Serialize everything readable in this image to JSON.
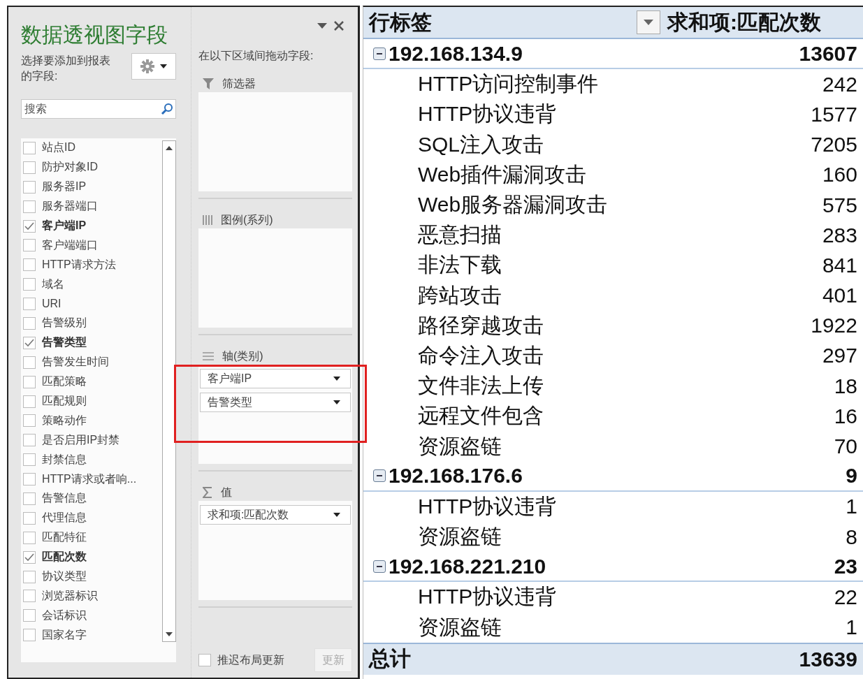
{
  "field_panel": {
    "title": "数据透视图字段",
    "instruction": "选择要添加到报表的字段:",
    "search": {
      "placeholder": "搜索"
    },
    "fields": [
      {
        "label": "站点ID",
        "checked": false
      },
      {
        "label": "防护对象ID",
        "checked": false
      },
      {
        "label": "服务器IP",
        "checked": false
      },
      {
        "label": "服务器端口",
        "checked": false
      },
      {
        "label": "客户端IP",
        "checked": true
      },
      {
        "label": "客户端端口",
        "checked": false
      },
      {
        "label": "HTTP请求方法",
        "checked": false
      },
      {
        "label": "域名",
        "checked": false
      },
      {
        "label": "URI",
        "checked": false
      },
      {
        "label": "告警级别",
        "checked": false
      },
      {
        "label": "告警类型",
        "checked": true
      },
      {
        "label": "告警发生时间",
        "checked": false
      },
      {
        "label": "匹配策略",
        "checked": false
      },
      {
        "label": "匹配规则",
        "checked": false
      },
      {
        "label": "策略动作",
        "checked": false
      },
      {
        "label": "是否启用IP封禁",
        "checked": false
      },
      {
        "label": "封禁信息",
        "checked": false
      },
      {
        "label": "HTTP请求或者响...",
        "checked": false
      },
      {
        "label": "告警信息",
        "checked": false
      },
      {
        "label": "代理信息",
        "checked": false
      },
      {
        "label": "匹配特征",
        "checked": false
      },
      {
        "label": "匹配次数",
        "checked": true
      },
      {
        "label": "协议类型",
        "checked": false
      },
      {
        "label": "浏览器标识",
        "checked": false
      },
      {
        "label": "会话标识",
        "checked": false
      },
      {
        "label": "国家名字",
        "checked": false
      }
    ],
    "areas_hint": "在以下区域间拖动字段:",
    "areas": [
      {
        "kind": "filter",
        "label": "筛选器"
      },
      {
        "kind": "legend",
        "label": "图例(系列)"
      },
      {
        "kind": "axis",
        "label": "轴(类别)",
        "items": [
          "客户端IP",
          "告警类型"
        ],
        "highlighted": true
      },
      {
        "kind": "values",
        "label": "值",
        "items": [
          "求和项:匹配次数"
        ]
      }
    ],
    "defer_update": {
      "label": "推迟布局更新",
      "checked": false
    },
    "update_button": {
      "label": "更新",
      "disabled": true
    }
  },
  "pivot_table": {
    "columns": [
      "行标签",
      "求和项:匹配次数"
    ],
    "groups": [
      {
        "label": "192.168.134.9",
        "total": "13607",
        "expanded": true,
        "rows": [
          {
            "label": "HTTP访问控制事件",
            "value": "242"
          },
          {
            "label": "HTTP协议违背",
            "value": "1577"
          },
          {
            "label": "SQL注入攻击",
            "value": "7205"
          },
          {
            "label": "Web插件漏洞攻击",
            "value": "160"
          },
          {
            "label": "Web服务器漏洞攻击",
            "value": "575"
          },
          {
            "label": "恶意扫描",
            "value": "283"
          },
          {
            "label": "非法下载",
            "value": "841"
          },
          {
            "label": "跨站攻击",
            "value": "401"
          },
          {
            "label": "路径穿越攻击",
            "value": "1922"
          },
          {
            "label": "命令注入攻击",
            "value": "297"
          },
          {
            "label": "文件非法上传",
            "value": "18"
          },
          {
            "label": "远程文件包含",
            "value": "16"
          },
          {
            "label": "资源盗链",
            "value": "70"
          }
        ]
      },
      {
        "label": "192.168.176.6",
        "total": "9",
        "expanded": true,
        "rows": [
          {
            "label": "HTTP协议违背",
            "value": "1"
          },
          {
            "label": "资源盗链",
            "value": "8"
          }
        ]
      },
      {
        "label": "192.168.221.210",
        "total": "23",
        "expanded": true,
        "rows": [
          {
            "label": "HTTP协议违背",
            "value": "22"
          },
          {
            "label": "资源盗链",
            "value": "1"
          }
        ]
      }
    ],
    "grand_total": {
      "label": "总计",
      "value": "13639"
    }
  }
}
